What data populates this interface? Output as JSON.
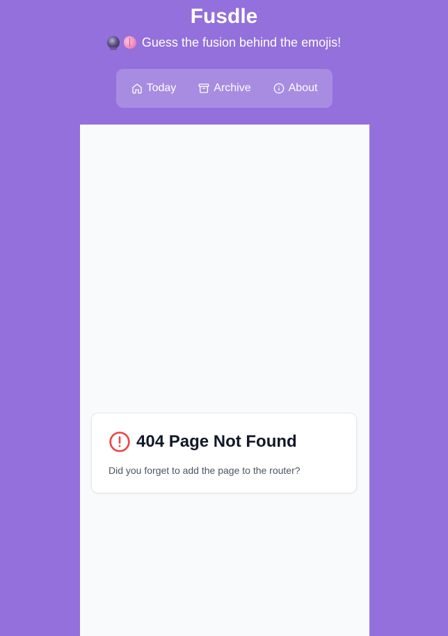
{
  "header": {
    "title": "Fusdle",
    "subtitle": "Guess the fusion behind the emojis!",
    "emojis": [
      "crystal-ball",
      "brain"
    ]
  },
  "nav": {
    "items": [
      {
        "label": "Today",
        "icon": "home-icon"
      },
      {
        "label": "Archive",
        "icon": "archive-icon"
      },
      {
        "label": "About",
        "icon": "info-icon"
      }
    ]
  },
  "error": {
    "title": "404 Page Not Found",
    "message": "Did you forget to add the page to the router?",
    "icon": "alert-circle-icon"
  },
  "colors": {
    "background": "#9370db",
    "panel": "#f9fafb",
    "error": "#ef4444",
    "title_text": "#111827"
  }
}
